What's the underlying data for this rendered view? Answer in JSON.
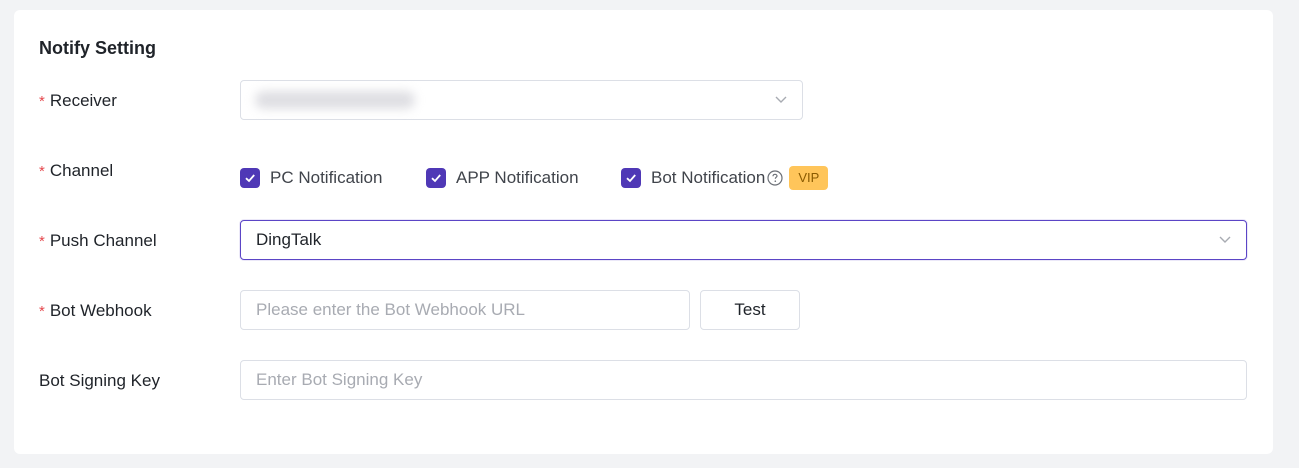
{
  "section": {
    "title": "Notify Setting"
  },
  "form": {
    "receiver": {
      "label": "Receiver",
      "required_mark": "*"
    },
    "channel": {
      "label": "Channel",
      "required_mark": "*",
      "options": [
        {
          "label": "PC Notification",
          "checked": true
        },
        {
          "label": "APP Notification",
          "checked": true
        },
        {
          "label": "Bot Notification",
          "checked": true
        }
      ],
      "vip_badge": "VIP"
    },
    "push_channel": {
      "label": "Push Channel",
      "required_mark": "*",
      "value": "DingTalk"
    },
    "bot_webhook": {
      "label": "Bot Webhook",
      "required_mark": "*",
      "placeholder": "Please enter the Bot Webhook URL",
      "test_button": "Test"
    },
    "bot_signing_key": {
      "label": "Bot Signing Key",
      "placeholder": "Enter Bot Signing Key"
    }
  },
  "colors": {
    "accent": "#4f38b6",
    "required": "#e5484d",
    "vip_bg": "#ffc55a",
    "page_bg": "#f2f3f5"
  },
  "icons": {
    "dropdown": "chevron-down-icon",
    "checkbox": "check-icon",
    "help": "question-circle-icon"
  }
}
